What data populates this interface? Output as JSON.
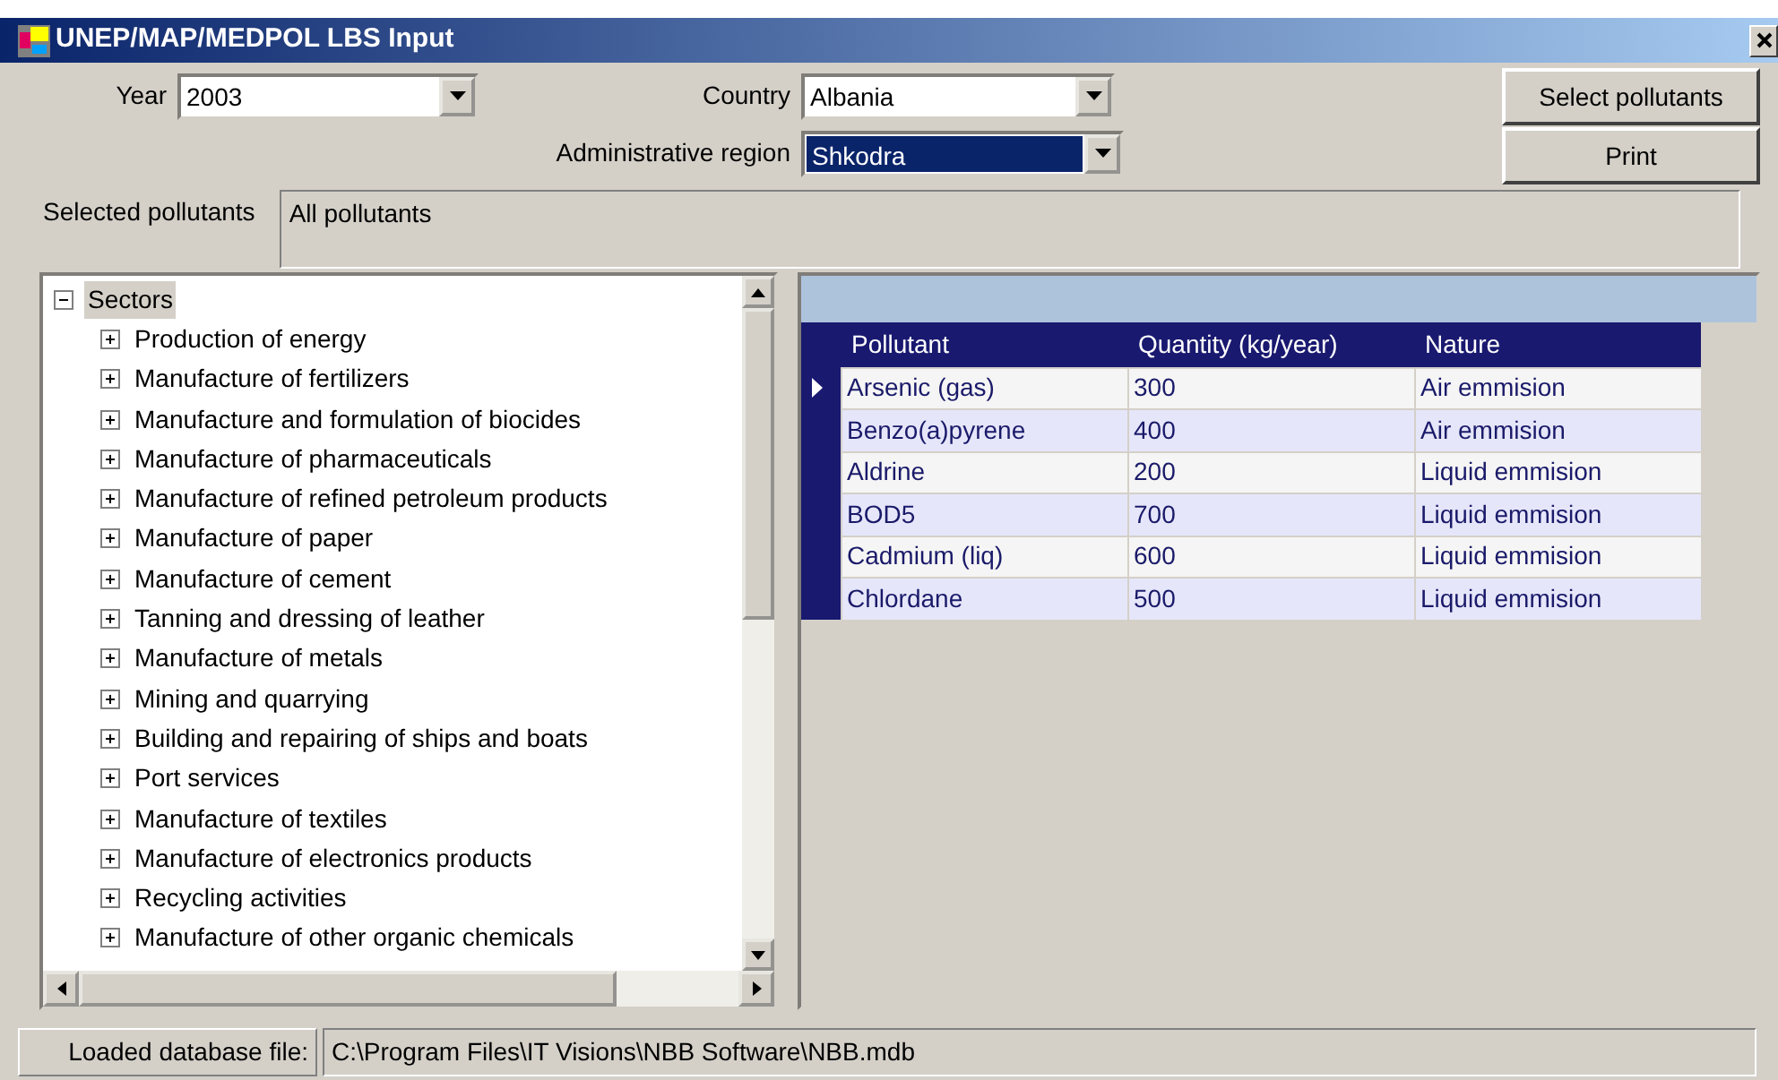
{
  "window": {
    "title": "UNEP/MAP/MEDPOL LBS Input"
  },
  "filters": [
    {
      "kind": "year",
      "label": "Year",
      "value": "2003",
      "focused": false
    },
    {
      "kind": "country",
      "label": "Country",
      "value": "Albania",
      "focused": false
    },
    {
      "kind": "region",
      "label": "Administrative region",
      "value": "Shkodra",
      "focused": true
    }
  ],
  "buttons": [
    "Select pollutants",
    "Print"
  ],
  "selected_pollutants": {
    "label": "Selected pollutants",
    "value": "All pollutants"
  },
  "tree": {
    "label": "Sectors",
    "expanded": true,
    "selected": true,
    "children": [
      {
        "label": "Production of energy",
        "expanded": false,
        "selected": false
      },
      {
        "label": "Manufacture of fertilizers",
        "expanded": false,
        "selected": false
      },
      {
        "label": "Manufacture and formulation of biocides",
        "expanded": false,
        "selected": false
      },
      {
        "label": "Manufacture of pharmaceuticals",
        "expanded": false,
        "selected": false
      },
      {
        "label": "Manufacture of refined petroleum products",
        "expanded": false,
        "selected": false
      },
      {
        "label": "Manufacture of paper",
        "expanded": false,
        "selected": false
      },
      {
        "label": "Manufacture of cement",
        "expanded": false,
        "selected": false
      },
      {
        "label": "Tanning and dressing of leather",
        "expanded": false,
        "selected": false
      },
      {
        "label": "Manufacture of metals",
        "expanded": false,
        "selected": false
      },
      {
        "label": "Mining and quarrying",
        "expanded": false,
        "selected": false
      },
      {
        "label": "Building and repairing of ships and boats",
        "expanded": false,
        "selected": false
      },
      {
        "label": "Port services",
        "expanded": false,
        "selected": false
      },
      {
        "label": "Manufacture of textiles",
        "expanded": false,
        "selected": false
      },
      {
        "label": "Manufacture of electronics products",
        "expanded": false,
        "selected": false
      },
      {
        "label": "Recycling activities",
        "expanded": false,
        "selected": false
      },
      {
        "label": "Manufacture of other organic chemicals",
        "expanded": false,
        "selected": false
      }
    ]
  },
  "grid": {
    "columns": [
      "Pollutant",
      "Quantity (kg/year)",
      "Nature"
    ],
    "rows": [
      {
        "cells": [
          "Arsenic (gas)",
          "300",
          "Air emmision"
        ],
        "current": true
      },
      {
        "cells": [
          "Benzo(a)pyrene",
          "400",
          "Air emmision"
        ],
        "current": false
      },
      {
        "cells": [
          "Aldrine",
          "200",
          "Liquid emmision"
        ],
        "current": false
      },
      {
        "cells": [
          "BOD5",
          "700",
          "Liquid emmision"
        ],
        "current": false
      },
      {
        "cells": [
          "Cadmium (liq)",
          "600",
          "Liquid emmision"
        ],
        "current": false
      },
      {
        "cells": [
          "Chlordane",
          "500",
          "Liquid emmision"
        ],
        "current": false
      }
    ]
  },
  "status_bar": {
    "label": "Loaded database file:",
    "value": "C:\\Program Files\\IT Visions\\NBB Software\\NBB.mdb"
  }
}
